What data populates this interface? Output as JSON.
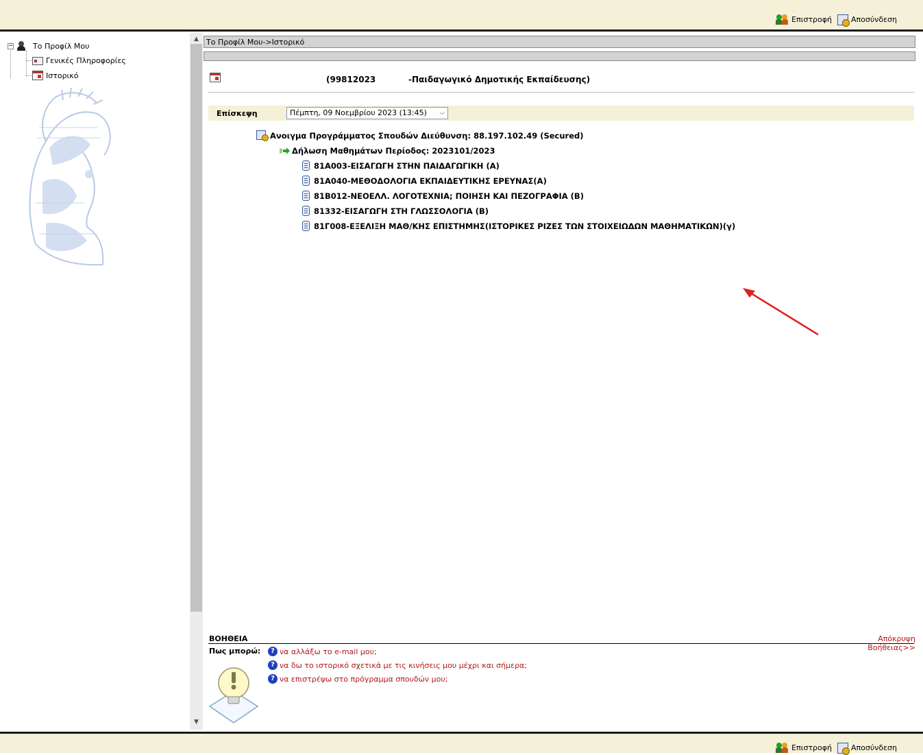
{
  "header": {
    "back_label": "Επιστροφή",
    "logout_label": "Αποσύνδεση"
  },
  "sidebar": {
    "root_label": "Το Προφίλ Μου",
    "items": [
      {
        "label": "Γενικές Πληροφορίες",
        "icon": "id-card-icon"
      },
      {
        "label": "Ιστορικό",
        "icon": "calendar-icon"
      }
    ]
  },
  "breadcrumb": "Το Προφίλ Μου->Ιστορικό",
  "student": {
    "code": "(99812023",
    "department": "-Παιδαγωγικό Δημοτικής Εκπαίδευσης)"
  },
  "visit": {
    "label": "Επίσκεψη",
    "selected": "Πέμπτη, 09 Νοεμβρίου 2023 (13:45)"
  },
  "history": {
    "open_program": "Ανοιγμα Προγράμματος Σπουδών Διεύθυνση: 88.197.102.49 (Secured)",
    "declaration": "Δήλωση Μαθημάτων Περίοδος: 2023101/2023",
    "courses": [
      "81Α003-ΕΙΣΑΓΩΓΗ ΣΤΗΝ ΠΑΙΔΑΓΩΓΙΚΗ (Α)",
      "81Α040-ΜΕΘΟΔΟΛΟΓΙΑ ΕΚΠΑΙΔΕΥΤΙΚΗΣ ΕΡΕΥΝΑΣ(Α)",
      "81Β012-ΝΕΟΕΛΛ. ΛΟΓΟΤΕΧΝΙΑ; ΠΟΙΗΣΗ ΚΑΙ ΠΕΖΟΓΡΑΦΙΑ (Β)",
      "81332-ΕΙΣΑΓΩΓΗ ΣΤΗ ΓΛΩΣΣΟΛΟΓΙΑ (Β)",
      "81Γ008-ΕΞΕΛΙΞΗ ΜΑΘ/ΚΗΣ ΕΠΙΣΤΗΜΗΣ(ΙΣΤΟΡΙΚΕΣ ΡΙΖΕΣ ΤΩΝ ΣΤΟΙΧΕΙΩΔΩΝ ΜΑΘΗΜΑΤΙΚΩΝ)(γ)"
    ]
  },
  "help": {
    "title": "ΒΟΗΘΕΙΑ",
    "hide_label": "Απόκρυψη Βοήθειας>>",
    "how_label": "Πως μπορώ:",
    "items": [
      "να αλλάξω το e-mail μου;",
      "να δω το ιστορικό σχετικά με τις κινήσεις μου μέχρι και σήμερα;",
      "να επιστρέψω στο πρόγραμμα σπουδών μου;"
    ]
  },
  "colors": {
    "bar_bg": "#f5f0d8",
    "link_red": "#b01818",
    "annotation_arrow": "#e02020"
  }
}
